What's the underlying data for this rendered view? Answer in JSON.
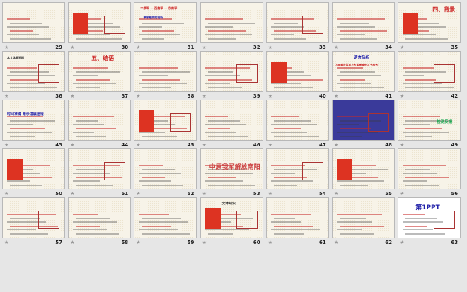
{
  "slides": [
    {
      "n": "29",
      "title": "",
      "extra": ""
    },
    {
      "n": "30",
      "title": "",
      "extra": ""
    },
    {
      "n": "31",
      "title": "中原军 — 西南军 — 东南军",
      "extra": "单序题的的视听"
    },
    {
      "n": "32",
      "title": "",
      "extra": ""
    },
    {
      "n": "33",
      "title": "",
      "extra": ""
    },
    {
      "n": "34",
      "title": "",
      "extra": ""
    },
    {
      "n": "35",
      "title": "四、背景",
      "extra": ""
    },
    {
      "n": "36",
      "title": "本文体裁资料",
      "extra": ""
    },
    {
      "n": "37",
      "title": "五、结语",
      "extra": ""
    },
    {
      "n": "38",
      "title": "",
      "extra": ""
    },
    {
      "n": "39",
      "title": "",
      "extra": ""
    },
    {
      "n": "40",
      "title": "",
      "extra": ""
    },
    {
      "n": "41",
      "title": "语言品析",
      "extra": "人民解放军百万大军横渡长江 气势大"
    },
    {
      "n": "42",
      "title": "",
      "extra": ""
    },
    {
      "n": "43",
      "title": "时间准确 暗示进展迅速",
      "extra": ""
    },
    {
      "n": "44",
      "title": "",
      "extra": ""
    },
    {
      "n": "45",
      "title": "",
      "extra": ""
    },
    {
      "n": "46",
      "title": "",
      "extra": ""
    },
    {
      "n": "47",
      "title": "",
      "extra": ""
    },
    {
      "n": "48",
      "title": "",
      "extra": ""
    },
    {
      "n": "49",
      "title": "检测反馈",
      "extra": ""
    },
    {
      "n": "50",
      "title": "",
      "extra": ""
    },
    {
      "n": "51",
      "title": "",
      "extra": ""
    },
    {
      "n": "52",
      "title": "",
      "extra": ""
    },
    {
      "n": "53",
      "title": "中原我军解放南阳",
      "extra": ""
    },
    {
      "n": "54",
      "title": "",
      "extra": ""
    },
    {
      "n": "55",
      "title": "",
      "extra": ""
    },
    {
      "n": "56",
      "title": "",
      "extra": ""
    },
    {
      "n": "57",
      "title": "",
      "extra": ""
    },
    {
      "n": "58",
      "title": "",
      "extra": ""
    },
    {
      "n": "59",
      "title": "",
      "extra": ""
    },
    {
      "n": "60",
      "title": "文体知识",
      "extra": ""
    },
    {
      "n": "61",
      "title": "",
      "extra": ""
    },
    {
      "n": "62",
      "title": "",
      "extra": ""
    },
    {
      "n": "63",
      "title": "第1PPT",
      "extra": ""
    }
  ],
  "colors": {
    "accent_red": "#cc2222",
    "title_blue": "#2b2b9a",
    "slide_bg": "#f7f3e8",
    "page_bg": "#e6e6e6"
  }
}
